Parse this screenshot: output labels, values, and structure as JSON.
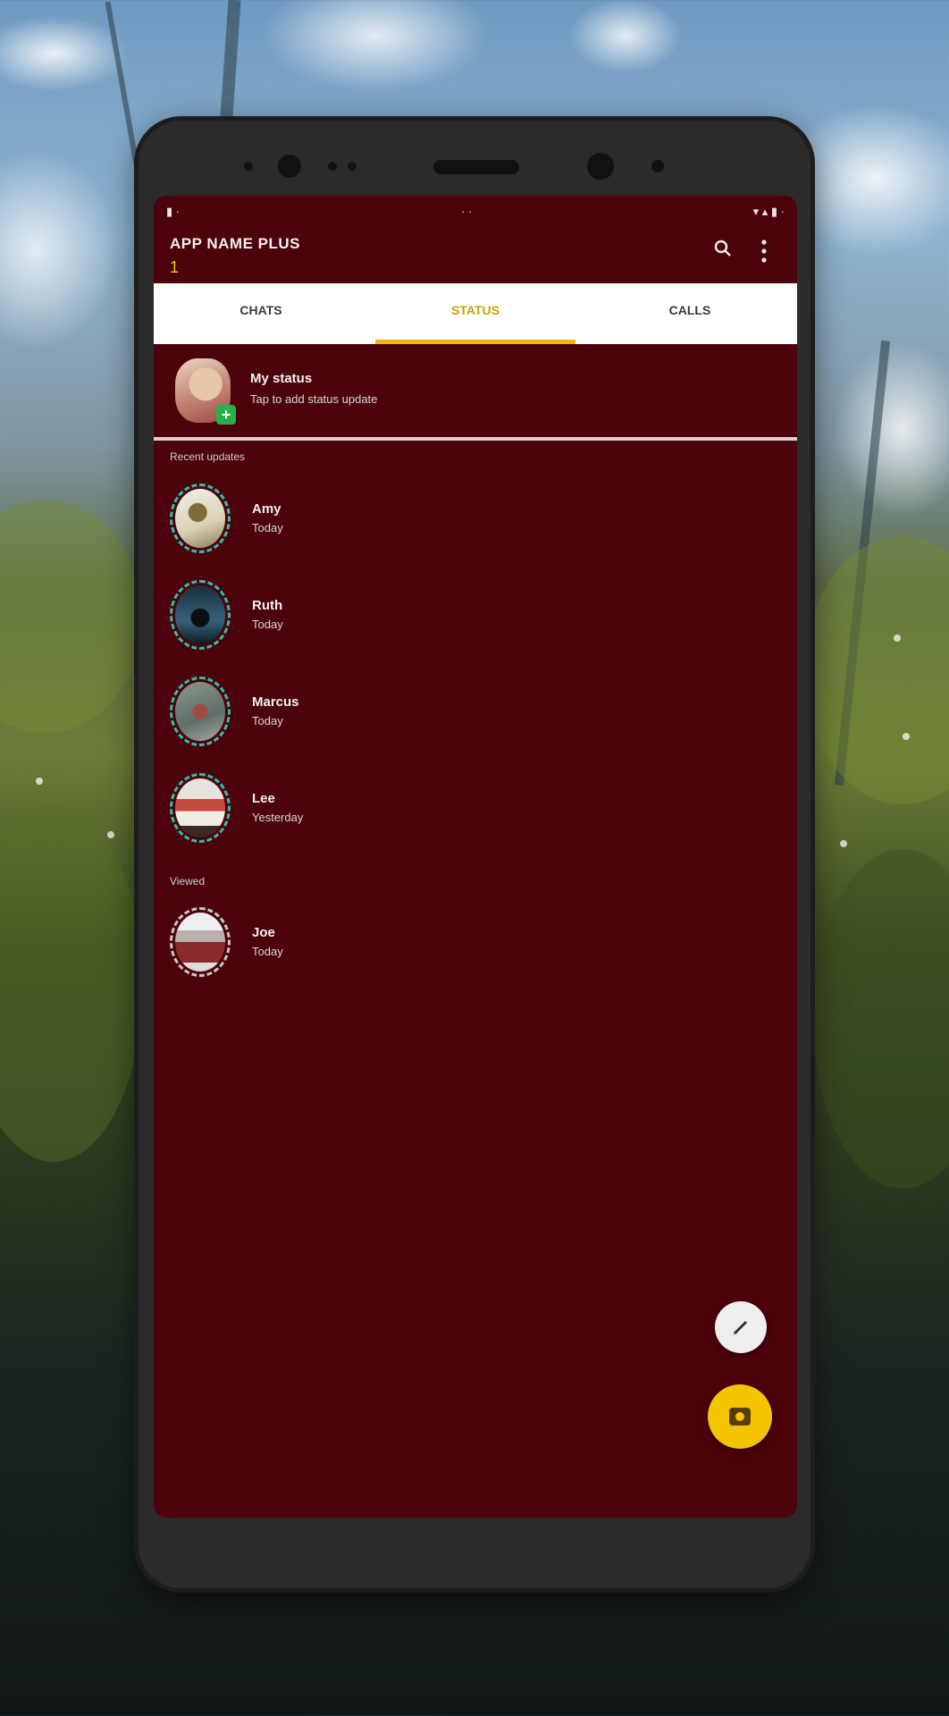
{
  "statusbar": {
    "left": "▮ ·",
    "center": "· ·",
    "right": "▾ ▴ ▮ ·"
  },
  "appbar": {
    "title": "APP NAME PLUS",
    "badge": "1",
    "search_icon": "search-icon",
    "menu_icon": "more-vert-icon"
  },
  "tabs": [
    {
      "label": "CHATS",
      "active": false
    },
    {
      "label": "STATUS",
      "active": true
    },
    {
      "label": "CALLS",
      "active": false
    }
  ],
  "my_status": {
    "title": "My status",
    "subtitle": "Tap to add status update"
  },
  "sections": {
    "recent": "Recent updates",
    "viewed": "Viewed"
  },
  "recent_updates": [
    {
      "name": "Amy",
      "time": "Today"
    },
    {
      "name": "Ruth",
      "time": "Today"
    },
    {
      "name": "Marcus",
      "time": "Today"
    },
    {
      "name": "Lee",
      "time": "Yesterday"
    }
  ],
  "viewed_updates": [
    {
      "name": "Joe",
      "time": "Today"
    }
  ],
  "fabs": {
    "edit_icon": "pencil-icon",
    "camera_icon": "camera-icon"
  },
  "colors": {
    "screen_bg": "#4c020a",
    "accent": "#f5c400",
    "ring_unviewed": "#2fbfb0",
    "add_badge": "#24b04a"
  }
}
